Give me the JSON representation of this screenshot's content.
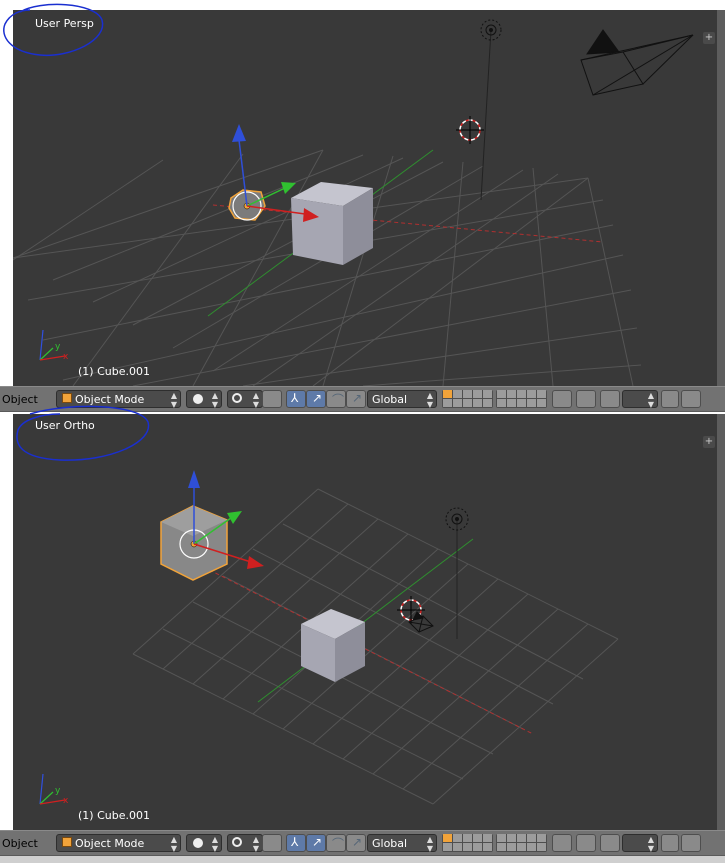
{
  "top_viewport": {
    "view_name": "User Persp",
    "active_object": "(1) Cube.001",
    "axis_labels": {
      "x": "x",
      "y": "y"
    }
  },
  "bottom_viewport": {
    "view_name": "User Ortho",
    "active_object": "(1) Cube.001",
    "axis_labels": {
      "x": "x",
      "y": "y"
    }
  },
  "header": {
    "menu_label": "Object",
    "mode": "Object Mode",
    "orientation": "Global",
    "plus_label": "+"
  },
  "colors": {
    "viewport_bg": "#393939",
    "header_bg": "#727272",
    "grid": "#555555",
    "x_axis": "#b03030",
    "y_axis": "#2f8f2f",
    "selection": "#f1a33a",
    "annotation": "#1a2fd0"
  }
}
